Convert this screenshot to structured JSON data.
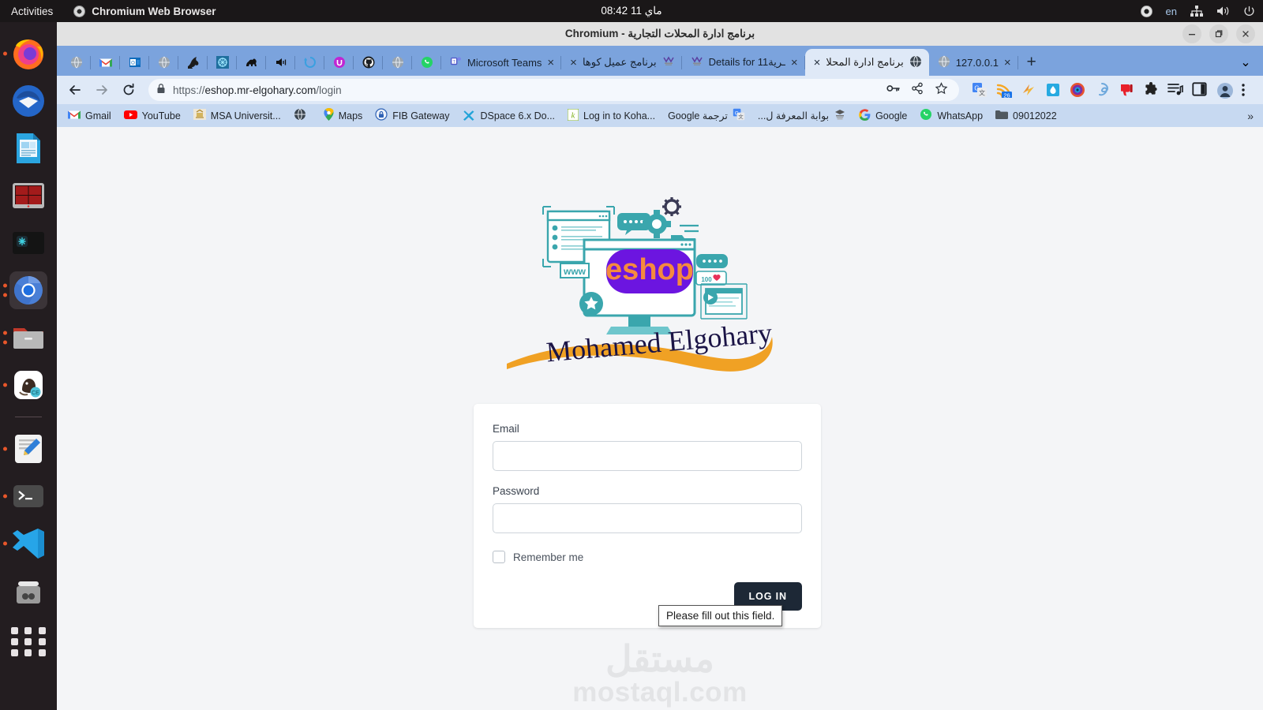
{
  "desktop": {
    "activities": "Activities",
    "focused_app": "Chromium Web Browser",
    "clock": "ماي 11  08:42",
    "tray": {
      "language": "en"
    },
    "dock_items": [
      {
        "name": "firefox",
        "running": true
      },
      {
        "name": "thunderbird",
        "running": false
      },
      {
        "name": "libreoffice-writer",
        "running": false
      },
      {
        "name": "terminal-grid",
        "running": false
      },
      {
        "name": "snowflake-app",
        "running": false
      },
      {
        "name": "chromium",
        "running": true
      },
      {
        "name": "files",
        "running": true
      },
      {
        "name": "dbeaver",
        "running": true
      },
      {
        "name": "text-editor",
        "running": true
      },
      {
        "name": "terminal",
        "running": true
      },
      {
        "name": "vscode",
        "running": true
      },
      {
        "name": "trash",
        "running": false
      }
    ]
  },
  "window": {
    "title": "برنامج ادارة المحلات التجارية - Chromium",
    "controls": {
      "minimize": "minimize",
      "maximize": "maximize",
      "close": "close"
    }
  },
  "tabs": {
    "favicon_only": [
      "globe",
      "gmail",
      "outlook",
      "globe",
      "raptor",
      "pattern",
      "camel",
      "speaker",
      "loop",
      "ublock",
      "github",
      "globe",
      "whatsapp"
    ],
    "titled": [
      {
        "label": "Microsoft Teams",
        "close": "×",
        "active": false,
        "rtl": false,
        "icon": "teams"
      },
      {
        "label": "برنامج عميل كوها",
        "close": "×",
        "active": false,
        "rtl": true,
        "icon": "koha"
      },
      {
        "label": "Details for 11ـرية",
        "close": "×",
        "active": false,
        "rtl": false,
        "icon": "koha"
      },
      {
        "label": "برنامج ادارة المحلا",
        "close": "×",
        "active": true,
        "rtl": true,
        "icon": "globe"
      },
      {
        "label": "127.0.0.1",
        "close": "×",
        "active": false,
        "rtl": false,
        "icon": "globe"
      }
    ],
    "new_tab": "+",
    "tab_list_chevron": "⌄"
  },
  "toolbar": {
    "back": "←",
    "forward": "→",
    "reload": "⟳",
    "url_scheme": "https://",
    "url_host": "eshop.mr-elgohary.com",
    "url_path": "/login",
    "lock_icon": "lock-icon",
    "password_key_icon": "key-icon",
    "share_icon": "share-icon",
    "bookmark_star_icon": "star-icon",
    "extensions": [
      "google-translate",
      "rss-reader-26",
      "lightning",
      "water-drop",
      "camera-lens",
      "spiral",
      "youtube-dislike",
      "puzzle-extensions",
      "media-playlist",
      "side-panel"
    ],
    "badge_count": "26",
    "profile_icon": "account-icon",
    "menu_icon": "three-dot-menu-icon"
  },
  "bookmarks": {
    "items": [
      {
        "label": "Gmail",
        "icon": "gmail",
        "rtl": false
      },
      {
        "label": "YouTube",
        "icon": "youtube",
        "rtl": false
      },
      {
        "label": "MSA Universit...",
        "icon": "msa",
        "rtl": false
      },
      {
        "label": "",
        "icon": "globe",
        "rtl": false
      },
      {
        "label": "Maps",
        "icon": "maps",
        "rtl": false
      },
      {
        "label": "FIB Gateway",
        "icon": "lock-blue",
        "rtl": false
      },
      {
        "label": "DSpace 6.x Do...",
        "icon": "dspace",
        "rtl": false
      },
      {
        "label": "Log in to Koha...",
        "icon": "koha-k",
        "rtl": false
      },
      {
        "label": "ترجمة Google",
        "icon": "translate",
        "rtl": true
      },
      {
        "label": "بوابة المعرفة ل...",
        "icon": "knowledge",
        "rtl": true
      },
      {
        "label": "Google",
        "icon": "google-g",
        "rtl": false
      },
      {
        "label": "WhatsApp",
        "icon": "whatsapp",
        "rtl": false
      },
      {
        "label": "09012022",
        "icon": "folder",
        "rtl": false
      }
    ],
    "overflow": "»"
  },
  "logo": {
    "badge_text": "eshop",
    "brand_text": "Mohamed Elgohary",
    "badge_color": "#6c15e0",
    "badge_text_color": "#f58a3e",
    "accent_color": "#3aa6ad",
    "swoosh_color": "#f0a124",
    "brand_color": "#1b1446",
    "www_label": "www",
    "likes_label": "100"
  },
  "login": {
    "email_label": "Email",
    "email_value": "",
    "password_label": "Password",
    "password_value": "",
    "remember_label": "Remember me",
    "remember_checked": false,
    "submit_label": "LOG IN",
    "validation_tooltip": "Please fill out this field."
  },
  "watermark": {
    "arabic": "مستقل",
    "latin": "mostaql.com"
  }
}
